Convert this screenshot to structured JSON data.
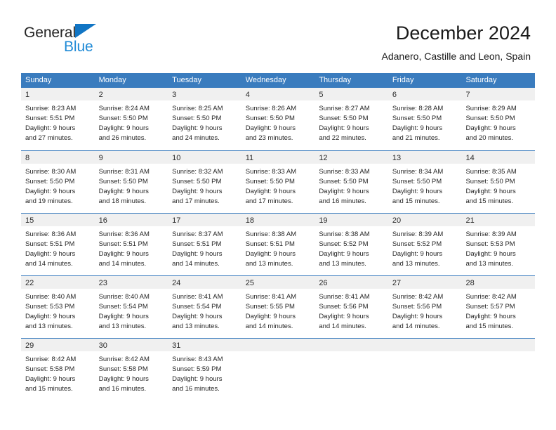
{
  "logo": {
    "word1": "General",
    "word2": "Blue",
    "triangle_color": "#1175c4",
    "word2_color": "#1f8ad6"
  },
  "header": {
    "title": "December 2024",
    "subtitle": "Adanero, Castille and Leon, Spain"
  },
  "theme": {
    "header_blue": "#3a7cbe",
    "day_band_gray": "#f0f0f0",
    "text_color": "#262626"
  },
  "calendar": {
    "weekday_headers": [
      "Sunday",
      "Monday",
      "Tuesday",
      "Wednesday",
      "Thursday",
      "Friday",
      "Saturday"
    ],
    "weeks": [
      [
        {
          "day": "1",
          "lines": [
            "Sunrise: 8:23 AM",
            "Sunset: 5:51 PM",
            "Daylight: 9 hours",
            "and 27 minutes."
          ]
        },
        {
          "day": "2",
          "lines": [
            "Sunrise: 8:24 AM",
            "Sunset: 5:50 PM",
            "Daylight: 9 hours",
            "and 26 minutes."
          ]
        },
        {
          "day": "3",
          "lines": [
            "Sunrise: 8:25 AM",
            "Sunset: 5:50 PM",
            "Daylight: 9 hours",
            "and 24 minutes."
          ]
        },
        {
          "day": "4",
          "lines": [
            "Sunrise: 8:26 AM",
            "Sunset: 5:50 PM",
            "Daylight: 9 hours",
            "and 23 minutes."
          ]
        },
        {
          "day": "5",
          "lines": [
            "Sunrise: 8:27 AM",
            "Sunset: 5:50 PM",
            "Daylight: 9 hours",
            "and 22 minutes."
          ]
        },
        {
          "day": "6",
          "lines": [
            "Sunrise: 8:28 AM",
            "Sunset: 5:50 PM",
            "Daylight: 9 hours",
            "and 21 minutes."
          ]
        },
        {
          "day": "7",
          "lines": [
            "Sunrise: 8:29 AM",
            "Sunset: 5:50 PM",
            "Daylight: 9 hours",
            "and 20 minutes."
          ]
        }
      ],
      [
        {
          "day": "8",
          "lines": [
            "Sunrise: 8:30 AM",
            "Sunset: 5:50 PM",
            "Daylight: 9 hours",
            "and 19 minutes."
          ]
        },
        {
          "day": "9",
          "lines": [
            "Sunrise: 8:31 AM",
            "Sunset: 5:50 PM",
            "Daylight: 9 hours",
            "and 18 minutes."
          ]
        },
        {
          "day": "10",
          "lines": [
            "Sunrise: 8:32 AM",
            "Sunset: 5:50 PM",
            "Daylight: 9 hours",
            "and 17 minutes."
          ]
        },
        {
          "day": "11",
          "lines": [
            "Sunrise: 8:33 AM",
            "Sunset: 5:50 PM",
            "Daylight: 9 hours",
            "and 17 minutes."
          ]
        },
        {
          "day": "12",
          "lines": [
            "Sunrise: 8:33 AM",
            "Sunset: 5:50 PM",
            "Daylight: 9 hours",
            "and 16 minutes."
          ]
        },
        {
          "day": "13",
          "lines": [
            "Sunrise: 8:34 AM",
            "Sunset: 5:50 PM",
            "Daylight: 9 hours",
            "and 15 minutes."
          ]
        },
        {
          "day": "14",
          "lines": [
            "Sunrise: 8:35 AM",
            "Sunset: 5:50 PM",
            "Daylight: 9 hours",
            "and 15 minutes."
          ]
        }
      ],
      [
        {
          "day": "15",
          "lines": [
            "Sunrise: 8:36 AM",
            "Sunset: 5:51 PM",
            "Daylight: 9 hours",
            "and 14 minutes."
          ]
        },
        {
          "day": "16",
          "lines": [
            "Sunrise: 8:36 AM",
            "Sunset: 5:51 PM",
            "Daylight: 9 hours",
            "and 14 minutes."
          ]
        },
        {
          "day": "17",
          "lines": [
            "Sunrise: 8:37 AM",
            "Sunset: 5:51 PM",
            "Daylight: 9 hours",
            "and 14 minutes."
          ]
        },
        {
          "day": "18",
          "lines": [
            "Sunrise: 8:38 AM",
            "Sunset: 5:51 PM",
            "Daylight: 9 hours",
            "and 13 minutes."
          ]
        },
        {
          "day": "19",
          "lines": [
            "Sunrise: 8:38 AM",
            "Sunset: 5:52 PM",
            "Daylight: 9 hours",
            "and 13 minutes."
          ]
        },
        {
          "day": "20",
          "lines": [
            "Sunrise: 8:39 AM",
            "Sunset: 5:52 PM",
            "Daylight: 9 hours",
            "and 13 minutes."
          ]
        },
        {
          "day": "21",
          "lines": [
            "Sunrise: 8:39 AM",
            "Sunset: 5:53 PM",
            "Daylight: 9 hours",
            "and 13 minutes."
          ]
        }
      ],
      [
        {
          "day": "22",
          "lines": [
            "Sunrise: 8:40 AM",
            "Sunset: 5:53 PM",
            "Daylight: 9 hours",
            "and 13 minutes."
          ]
        },
        {
          "day": "23",
          "lines": [
            "Sunrise: 8:40 AM",
            "Sunset: 5:54 PM",
            "Daylight: 9 hours",
            "and 13 minutes."
          ]
        },
        {
          "day": "24",
          "lines": [
            "Sunrise: 8:41 AM",
            "Sunset: 5:54 PM",
            "Daylight: 9 hours",
            "and 13 minutes."
          ]
        },
        {
          "day": "25",
          "lines": [
            "Sunrise: 8:41 AM",
            "Sunset: 5:55 PM",
            "Daylight: 9 hours",
            "and 14 minutes."
          ]
        },
        {
          "day": "26",
          "lines": [
            "Sunrise: 8:41 AM",
            "Sunset: 5:56 PM",
            "Daylight: 9 hours",
            "and 14 minutes."
          ]
        },
        {
          "day": "27",
          "lines": [
            "Sunrise: 8:42 AM",
            "Sunset: 5:56 PM",
            "Daylight: 9 hours",
            "and 14 minutes."
          ]
        },
        {
          "day": "28",
          "lines": [
            "Sunrise: 8:42 AM",
            "Sunset: 5:57 PM",
            "Daylight: 9 hours",
            "and 15 minutes."
          ]
        }
      ],
      [
        {
          "day": "29",
          "lines": [
            "Sunrise: 8:42 AM",
            "Sunset: 5:58 PM",
            "Daylight: 9 hours",
            "and 15 minutes."
          ]
        },
        {
          "day": "30",
          "lines": [
            "Sunrise: 8:42 AM",
            "Sunset: 5:58 PM",
            "Daylight: 9 hours",
            "and 16 minutes."
          ]
        },
        {
          "day": "31",
          "lines": [
            "Sunrise: 8:43 AM",
            "Sunset: 5:59 PM",
            "Daylight: 9 hours",
            "and 16 minutes."
          ]
        },
        {
          "day": "",
          "lines": []
        },
        {
          "day": "",
          "lines": []
        },
        {
          "day": "",
          "lines": []
        },
        {
          "day": "",
          "lines": []
        }
      ]
    ]
  }
}
